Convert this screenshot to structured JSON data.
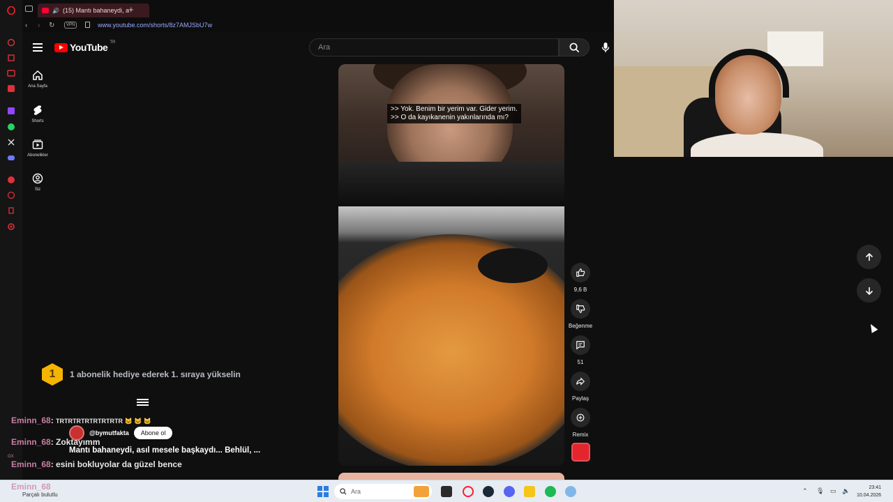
{
  "browser": {
    "tab_title": "(15) Mantı bahaneydi, a",
    "new_tab": "+",
    "vpn_label": "VPN",
    "url": "www.youtube.com/shorts/8z7AMJSbU7w"
  },
  "youtube": {
    "logo_text": "YouTube",
    "country": "TR",
    "search_placeholder": "Ara",
    "guide": [
      {
        "label": "Ana Sayfa",
        "icon": "home-icon"
      },
      {
        "label": "Shorts",
        "icon": "shorts-icon"
      },
      {
        "label": "Abonelikler",
        "icon": "subscriptions-icon"
      },
      {
        "label": "Siz",
        "icon": "you-icon"
      }
    ]
  },
  "short": {
    "subtitle_line1": ">> Yok. Benim bir yerim var. Gider yerim.",
    "subtitle_line2": ">> O da kayıkanenin yakınlarında mı?",
    "actions": {
      "like_count": "9,6 B",
      "dislike_label": "Beğenme",
      "comment_count": "51",
      "share_label": "Paylaş",
      "remix_label": "Remix"
    }
  },
  "overlay": {
    "sub_badge": "1",
    "sub_banner": "1 abonelik hediye ederek 1. sıraya yükselin",
    "chat": [
      {
        "user": "Eminn_68",
        "message": "TRTRTRTRTRTRTRTR 🐱 🐱 🐱"
      },
      {
        "user": "Eminn_68",
        "message": "Zoktayımm"
      },
      {
        "user": "Eminn_68",
        "message": "esini bokluyolar da güzel bence"
      },
      {
        "user": "Eminn_68",
        "message": ""
      }
    ],
    "channel_name": "@bymutfakta",
    "subscribe_label": "Abone ol",
    "video_title": "Mantı bahaneydi, asıl mesele başkaydı... Behlül, ...",
    "gx_label": "GX"
  },
  "taskbar": {
    "weather": "Parçalı bulutlu",
    "search_placeholder": "Ara",
    "time": "23:41",
    "date": "10.04.2026"
  },
  "colors": {
    "youtube_red": "#ff0000",
    "chat_user": "#c97ea6",
    "sub_badge": "#f5b400"
  }
}
